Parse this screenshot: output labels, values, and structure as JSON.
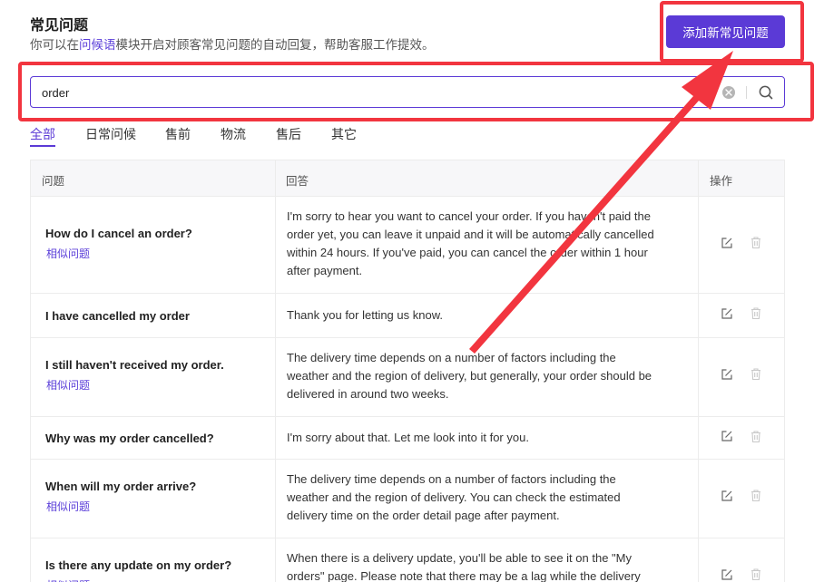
{
  "header": {
    "title": "常见问题",
    "subtitle_before": "你可以在",
    "subtitle_link": "问候语",
    "subtitle_after": "模块开启对顾客常见问题的自动回复，帮助客服工作提效。",
    "add_button_label": "添加新常见问题"
  },
  "search": {
    "value": "order",
    "icons": {
      "clear": "clear-icon",
      "search": "search-icon"
    }
  },
  "tabs": [
    {
      "label": "全部",
      "active": true
    },
    {
      "label": "日常问候",
      "active": false
    },
    {
      "label": "售前",
      "active": false
    },
    {
      "label": "物流",
      "active": false
    },
    {
      "label": "售后",
      "active": false
    },
    {
      "label": "其它",
      "active": false
    }
  ],
  "table": {
    "columns": {
      "question": "问题",
      "answer": "回答",
      "actions": "操作"
    },
    "similar_label": "相似问题",
    "rows": [
      {
        "question": "How do I cancel an order?",
        "has_similar": true,
        "answer": [
          "I'm sorry to hear you want to cancel your order. If you haven't paid the",
          "order yet, you can leave it unpaid and it will be automatically cancelled",
          "within 24 hours. If you've paid, you can cancel the order within 1 hour",
          "after payment."
        ]
      },
      {
        "question": "I have cancelled my order",
        "has_similar": false,
        "answer": [
          "Thank you for letting us know."
        ]
      },
      {
        "question": "I still haven't received my order.",
        "has_similar": true,
        "answer": [
          "The delivery time depends on a number of factors including the",
          "weather and the region of delivery, but generally, your order should be",
          "delivered in around two weeks."
        ]
      },
      {
        "question": "Why was my order cancelled?",
        "has_similar": false,
        "answer": [
          "I'm sorry about that. Let me look into it for you."
        ]
      },
      {
        "question": "When will my order arrive?",
        "has_similar": true,
        "answer": [
          "The delivery time depends on a number of factors including the",
          "weather and the region of delivery. You can check the estimated",
          "delivery time on the order detail page after payment."
        ]
      },
      {
        "question": "Is there any update on my order?",
        "has_similar": true,
        "answer": [
          "When there is a delivery update, you'll be able to see it on the \"My",
          "orders\" page. Please note that there may be a lag while the delivery"
        ]
      }
    ]
  },
  "annotation": {
    "highlight_color": "#f2353f",
    "accent_color": "#5b3ad6"
  }
}
